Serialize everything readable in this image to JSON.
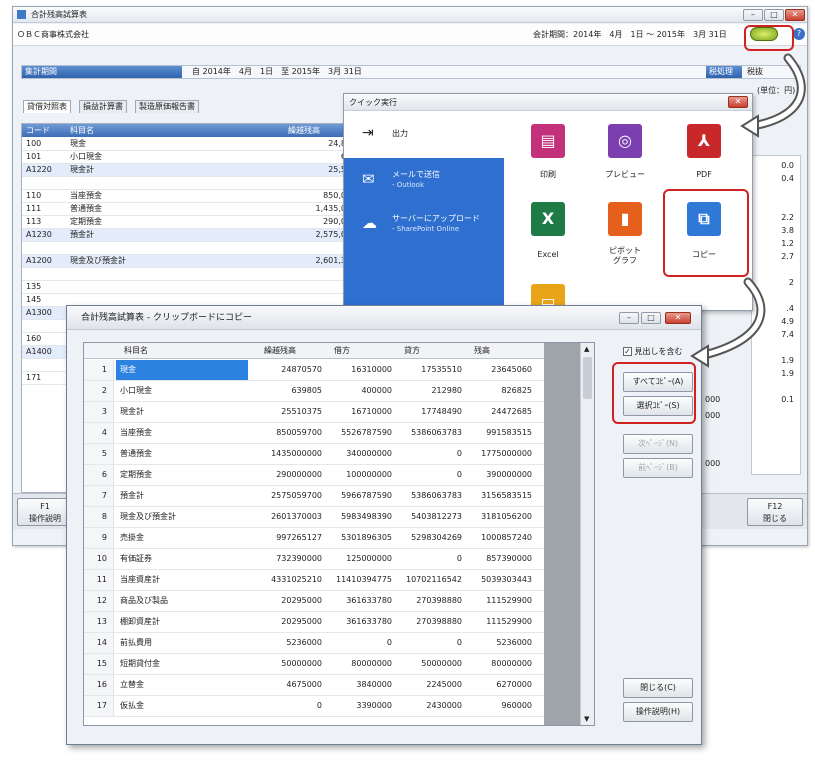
{
  "main": {
    "title": "合計残高試算表",
    "company": "ＯＢＣ商事株式会社",
    "period_label": "会計期間：2014年　4月　1日 ～ 2015年　3月 31日",
    "range_label": "集計期間",
    "range_value": "自 2014年　4月　1日　至 2015年　3月 31日",
    "tax_label": "税処理",
    "tax_value": "税抜",
    "unit_label": "(単位：",
    "unit_value": "円)",
    "tabs": [
      "貸借対照表",
      "損益計算書",
      "製造原価報告書"
    ],
    "fkeys": [
      {
        "key": "F1",
        "label": "操作説明"
      },
      {
        "key": "F12",
        "label": "閉じる"
      }
    ]
  },
  "bg_sheet": {
    "col_code": "コード",
    "col_name": "科目名",
    "col_prev": "繰越残高",
    "rows": [
      {
        "code": "100",
        "name": "現金",
        "value": "24,8"
      },
      {
        "code": "101",
        "name": "小口現金",
        "value": "6"
      },
      {
        "code": "A1220",
        "name": "現金計",
        "value": "25,5"
      },
      {
        "code": "",
        "name": "",
        "value": ""
      },
      {
        "code": "110",
        "name": "当座預金",
        "value": "850,0"
      },
      {
        "code": "111",
        "name": "普通預金",
        "value": "1,435,0"
      },
      {
        "code": "113",
        "name": "定期預金",
        "value": "290,0"
      },
      {
        "code": "A1230",
        "name": "預金計",
        "value": "2,575,0"
      },
      {
        "code": "",
        "name": "",
        "value": ""
      },
      {
        "code": "A1200",
        "name": "現金及び預金計",
        "value": "2,601,3"
      },
      {
        "code": "",
        "name": "",
        "value": ""
      },
      {
        "code": "135",
        "name": "",
        "value": ""
      },
      {
        "code": "145",
        "name": "",
        "value": ""
      },
      {
        "code": "A1300",
        "name": "",
        "value": ""
      },
      {
        "code": "",
        "name": "",
        "value": ""
      },
      {
        "code": "160",
        "name": "",
        "value": ""
      },
      {
        "code": "A1400",
        "name": "",
        "value": ""
      },
      {
        "code": "",
        "name": "",
        "value": ""
      },
      {
        "code": "171",
        "name": "",
        "value": ""
      }
    ],
    "right_values": [
      "0.0",
      "0.4",
      "",
      "",
      "2.2",
      "3.8",
      "1.2",
      "2.7",
      "",
      "2",
      "",
      ".4",
      "4.9",
      "7.4",
      "",
      "1.9",
      "1.9",
      "",
      "0.1"
    ],
    "right_mid_values": [
      "000",
      "000",
      "",
      "",
      "000"
    ]
  },
  "quick": {
    "title": "クイック実行",
    "output_label": "出力",
    "mail_label": "メールで送信",
    "mail_sub": "- Outlook",
    "upload_label": "サーバーにアップロード",
    "upload_sub": "- SharePoint Online",
    "tiles": [
      {
        "label": "印刷",
        "icon": "printer-icon",
        "color": "#c2317a"
      },
      {
        "label": "プレビュー",
        "icon": "preview-icon",
        "color": "#7b3fb0"
      },
      {
        "label": "PDF",
        "icon": "pdf-icon",
        "color": "#c8282a"
      },
      {
        "label": "Excel",
        "icon": "excel-icon",
        "color": "#1e7b45"
      },
      {
        "label": "ピボット\nグラフ",
        "icon": "pivot-chart-icon",
        "color": "#e5601c"
      },
      {
        "label": "コピー",
        "icon": "copy-icon",
        "color": "#2f78d6"
      }
    ]
  },
  "clipboard": {
    "title": "合計残高試算表 - クリップボードにコピー",
    "columns": [
      "科目名",
      "繰越残高",
      "借方",
      "貸方",
      "残高"
    ],
    "rows": [
      {
        "n": "1",
        "name": "現金",
        "prev": "24870570",
        "debit": "16310000",
        "credit": "17535510",
        "bal": "23645060"
      },
      {
        "n": "2",
        "name": "小口現金",
        "prev": "639805",
        "debit": "400000",
        "credit": "212980",
        "bal": "826825"
      },
      {
        "n": "3",
        "name": "現金計",
        "prev": "25510375",
        "debit": "16710000",
        "credit": "17748490",
        "bal": "24472685"
      },
      {
        "n": "4",
        "name": "当座預金",
        "prev": "850059700",
        "debit": "5526787590",
        "credit": "5386063783",
        "bal": "991583515"
      },
      {
        "n": "5",
        "name": "普通預金",
        "prev": "1435000000",
        "debit": "340000000",
        "credit": "0",
        "bal": "1775000000"
      },
      {
        "n": "6",
        "name": "定期預金",
        "prev": "290000000",
        "debit": "100000000",
        "credit": "0",
        "bal": "390000000"
      },
      {
        "n": "7",
        "name": "預金計",
        "prev": "2575059700",
        "debit": "5966787590",
        "credit": "5386063783",
        "bal": "3156583515"
      },
      {
        "n": "8",
        "name": "現金及び預金計",
        "prev": "2601370003",
        "debit": "5983498390",
        "credit": "5403812273",
        "bal": "3181056200"
      },
      {
        "n": "9",
        "name": "売掛金",
        "prev": "997265127",
        "debit": "5301896305",
        "credit": "5298304269",
        "bal": "1000857240"
      },
      {
        "n": "10",
        "name": "有価証券",
        "prev": "732390000",
        "debit": "125000000",
        "credit": "0",
        "bal": "857390000"
      },
      {
        "n": "11",
        "name": "当座資産計",
        "prev": "4331025210",
        "debit": "11410394775",
        "credit": "10702116542",
        "bal": "5039303443"
      },
      {
        "n": "12",
        "name": "商品及び製品",
        "prev": "20295000",
        "debit": "361633780",
        "credit": "270398880",
        "bal": "111529900"
      },
      {
        "n": "13",
        "name": "棚卸資産計",
        "prev": "20295000",
        "debit": "361633780",
        "credit": "270398880",
        "bal": "111529900"
      },
      {
        "n": "14",
        "name": "前払費用",
        "prev": "5236000",
        "debit": "0",
        "credit": "0",
        "bal": "5236000"
      },
      {
        "n": "15",
        "name": "短期貸付金",
        "prev": "50000000",
        "debit": "80000000",
        "credit": "50000000",
        "bal": "80000000"
      },
      {
        "n": "16",
        "name": "立替金",
        "prev": "4675000",
        "debit": "3840000",
        "credit": "2245000",
        "bal": "6270000"
      },
      {
        "n": "17",
        "name": "仮払金",
        "prev": "0",
        "debit": "3390000",
        "credit": "2430000",
        "bal": "960000"
      }
    ],
    "include_header_label": "見出しを含む",
    "btn_copy_all": "すべてｺﾋﾟｰ(A)",
    "btn_copy_selected": "選択ｺﾋﾟｰ(S)",
    "btn_next": "次ﾍﾟｰｼﾞ(N)",
    "btn_prev": "前ﾍﾟｰｼﾞ(B)",
    "btn_close": "閉じる(C)",
    "btn_help": "操作説明(H)"
  }
}
